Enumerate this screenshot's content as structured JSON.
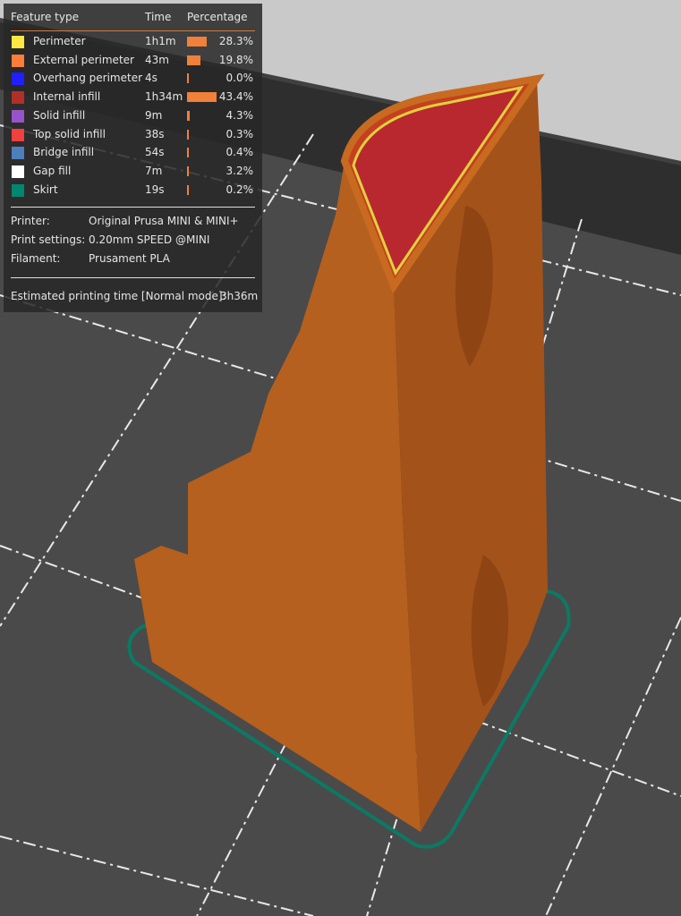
{
  "legend": {
    "headers": {
      "feature": "Feature type",
      "time": "Time",
      "percentage": "Percentage"
    },
    "items": [
      {
        "label": "Perimeter",
        "time": "1h1m",
        "percent": "28.3%",
        "value": 28.3,
        "color": "#ffe640"
      },
      {
        "label": "External perimeter",
        "time": "43m",
        "percent": "19.8%",
        "value": 19.8,
        "color": "#ff7d38"
      },
      {
        "label": "Overhang perimeter",
        "time": "4s",
        "percent": "0.0%",
        "value": 0.0,
        "color": "#1f1fff"
      },
      {
        "label": "Internal infill",
        "time": "1h34m",
        "percent": "43.4%",
        "value": 43.4,
        "color": "#b03029"
      },
      {
        "label": "Solid infill",
        "time": "9m",
        "percent": "4.3%",
        "value": 4.3,
        "color": "#9654cc"
      },
      {
        "label": "Top solid infill",
        "time": "38s",
        "percent": "0.3%",
        "value": 0.3,
        "color": "#f04040"
      },
      {
        "label": "Bridge infill",
        "time": "54s",
        "percent": "0.4%",
        "value": 0.4,
        "color": "#4d80ba"
      },
      {
        "label": "Gap fill",
        "time": "7m",
        "percent": "3.2%",
        "value": 3.2,
        "color": "#ffffff"
      },
      {
        "label": "Skirt",
        "time": "19s",
        "percent": "0.2%",
        "value": 0.2,
        "color": "#00876e"
      }
    ],
    "printer_label": "Printer:",
    "printer": "Original Prusa MINI & MINI+",
    "settings_label": "Print settings:",
    "settings": "0.20mm SPEED @MINI",
    "filament_label": "Filament:",
    "filament": "Prusament PLA",
    "estimate_label": "Estimated printing time [Normal mode]:",
    "estimate": "3h36m"
  }
}
